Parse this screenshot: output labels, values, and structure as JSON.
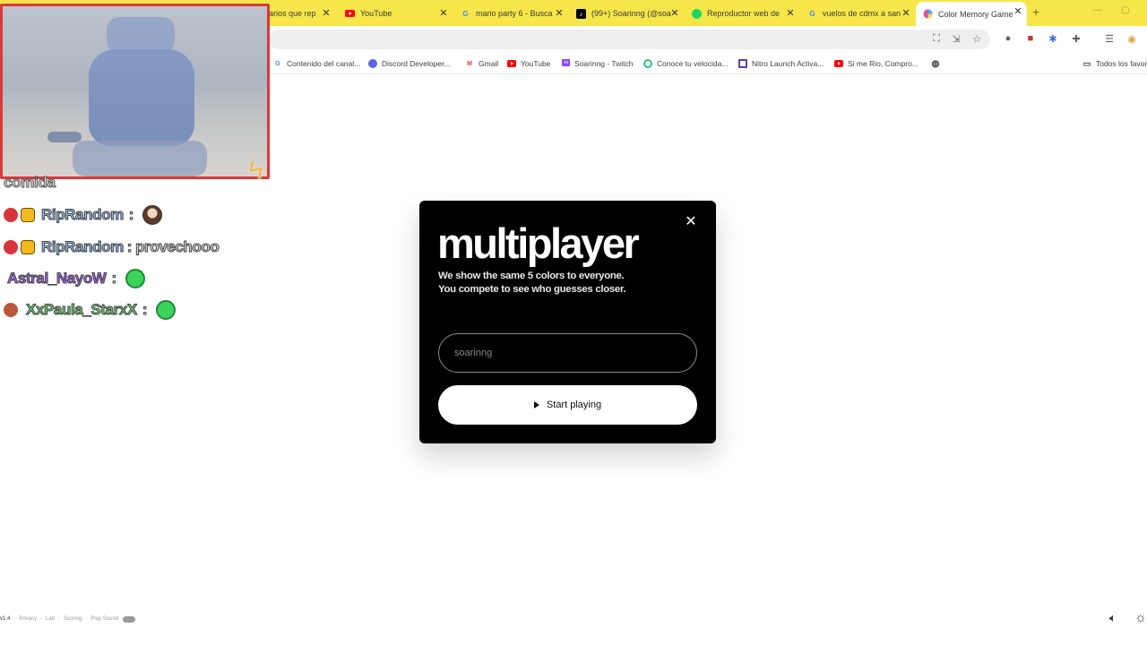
{
  "tabs": [
    {
      "title": "arios que rep",
      "icon": "partial-tab-icon",
      "color": "#9aa0a6",
      "active": false
    },
    {
      "title": "YouTube",
      "icon": "youtube-icon",
      "color": "#ff0000",
      "active": false
    },
    {
      "title": "mario party 6 - Busca",
      "icon": "google-icon",
      "color": "#4285f4",
      "active": false
    },
    {
      "title": "(99+) Soarinng (@soa",
      "icon": "tiktok-icon",
      "color": "#000000",
      "active": false
    },
    {
      "title": "Reproductor web de",
      "icon": "spotify-icon",
      "color": "#1ed760",
      "active": false
    },
    {
      "title": "vuelos de cdmx a san",
      "icon": "google-icon",
      "color": "#4285f4",
      "active": false
    },
    {
      "title": "Color Memory Game",
      "icon": "color-wheel-icon",
      "color": "#e0509a",
      "active": true
    }
  ],
  "tab_close_glyph": "✕",
  "new_tab_glyph": "+",
  "bookmarks": [
    {
      "label": "Contenido del canal...",
      "icon": "google-icon",
      "color": "#4285f4"
    },
    {
      "label": "Discord Developer...",
      "icon": "discord-icon",
      "color": "#5865f2"
    },
    {
      "label": "Gmail",
      "icon": "gmail-icon",
      "color": "#ea4335"
    },
    {
      "label": "YouTube",
      "icon": "youtube-icon",
      "color": "#ff0000"
    },
    {
      "label": "Soarinng - Twitch",
      "icon": "twitch-icon",
      "color": "#9146ff"
    },
    {
      "label": "Conoce tu velocida...",
      "icon": "speedtest-icon",
      "color": "#2ec27e"
    },
    {
      "label": "Nitro Launch Activa...",
      "icon": "nitro-icon",
      "color": "#5b3fa8"
    },
    {
      "label": "Si me Rio, Compro...",
      "icon": "youtube-icon",
      "color": "#ff0000"
    }
  ],
  "all_bookmarks_label": "Todos los favor",
  "chat": {
    "top_text": "comida",
    "messages": [
      {
        "badges": [
          "red",
          "crown"
        ],
        "user": "RipRandom",
        "user_color": "#8fb6e8",
        "separator": ":",
        "text": "",
        "emote": "avatar"
      },
      {
        "badges": [
          "red",
          "crown"
        ],
        "user": "RipRandom",
        "user_color": "#8fb6e8",
        "separator": ":",
        "text": "provechooo",
        "emote": ""
      },
      {
        "badges": [],
        "user": "Astral_NayoW",
        "user_color": "#a35cf0",
        "separator": ":",
        "text": "",
        "emote": "green"
      },
      {
        "badges": [
          "brown"
        ],
        "user": "XxPaula_StarxX",
        "user_color": "#63d36a",
        "separator": ":",
        "text": "",
        "emote": "green"
      }
    ]
  },
  "modal": {
    "title": "multiplayer",
    "description_line1": "We show the same 5 colors to everyone.",
    "description_line2": "You compete to see who guesses closer.",
    "input_placeholder": "soarinng",
    "start_button_label": "Start playing",
    "close_glyph": "✕"
  },
  "footer": {
    "version": "v1.4",
    "links": [
      "Privacy",
      "Lab",
      "Scoring",
      "Play Sound"
    ]
  }
}
